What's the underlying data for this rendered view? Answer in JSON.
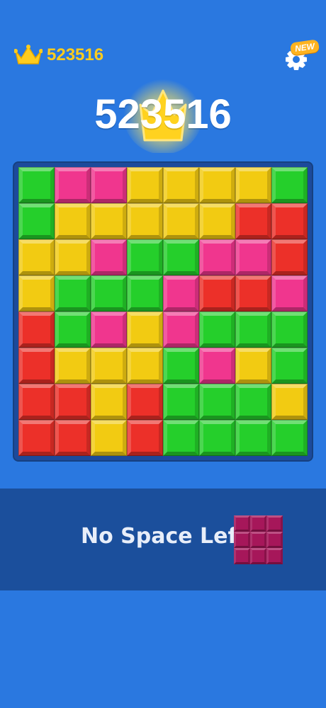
{
  "header": {
    "best_score": "523516",
    "settings_badge": "NEW",
    "score": "523516"
  },
  "colors": {
    "background": "#2a78e0",
    "green": "#25cf2b",
    "pink": "#f0368e",
    "yellow": "#f2cb12",
    "red": "#ec3029",
    "piece": "#a6175a",
    "crown": "#ffcc1e"
  },
  "board": {
    "rows": [
      [
        "g",
        "p",
        "p",
        "y",
        "y",
        "y",
        "y",
        "g"
      ],
      [
        "g",
        "y",
        "y",
        "y",
        "y",
        "y",
        "r",
        "r"
      ],
      [
        "y",
        "y",
        "p",
        "g",
        "g",
        "p",
        "p",
        "r"
      ],
      [
        "y",
        "g",
        "g",
        "g",
        "p",
        "r",
        "r",
        "p"
      ],
      [
        "r",
        "g",
        "p",
        "y",
        "p",
        "g",
        "g",
        "g"
      ],
      [
        "r",
        "y",
        "y",
        "y",
        "g",
        "p",
        "y",
        "g"
      ],
      [
        "r",
        "r",
        "y",
        "r",
        "g",
        "g",
        "g",
        "y"
      ],
      [
        "r",
        "r",
        "y",
        "r",
        "g",
        "g",
        "g",
        "g"
      ]
    ]
  },
  "overlay": {
    "message": "No Space Left",
    "piece_shape": "3x3"
  },
  "icons": {
    "best": "crown-icon",
    "settings": "gear-icon",
    "score_bg": "crown-glow-icon"
  }
}
